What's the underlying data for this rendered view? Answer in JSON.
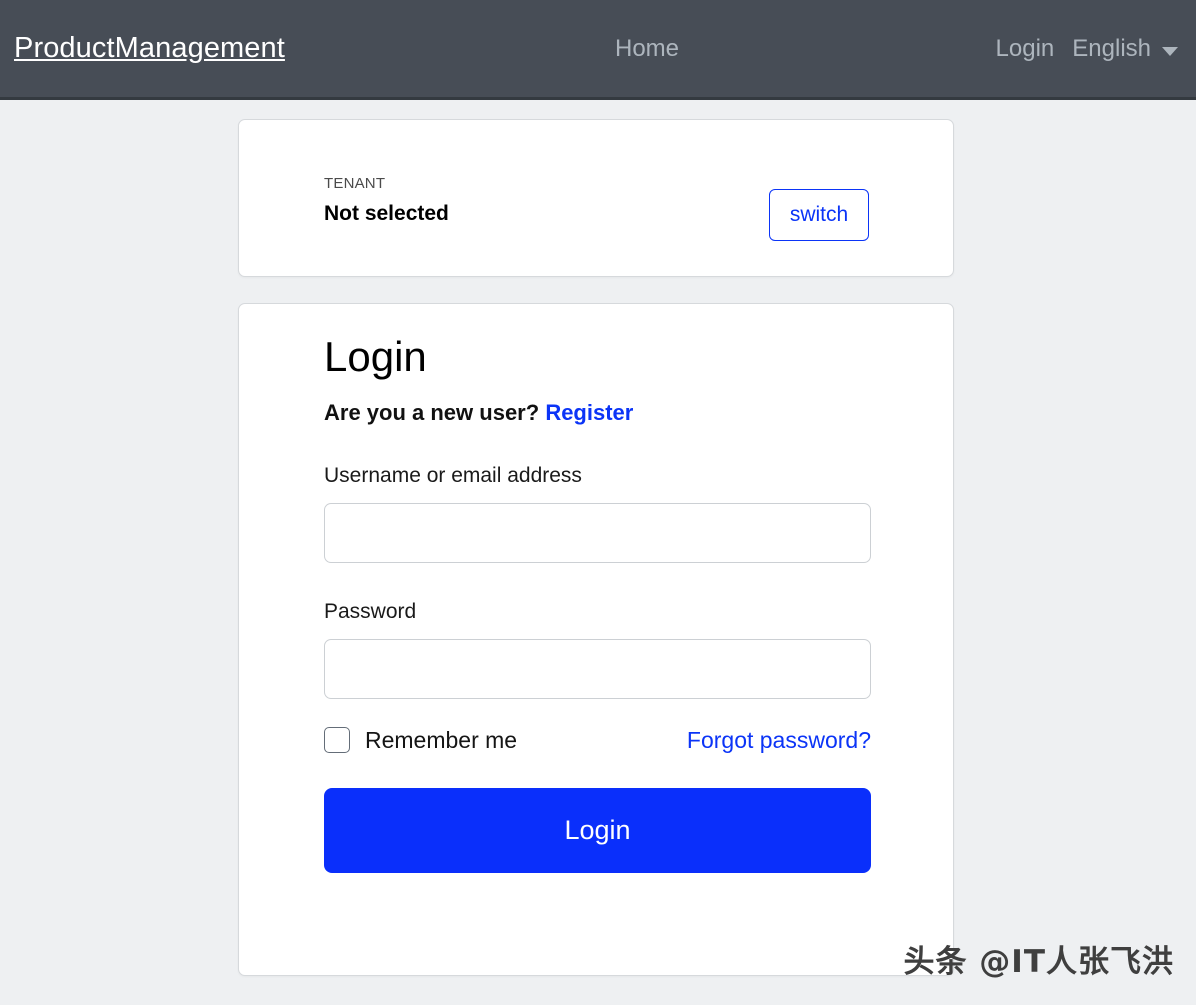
{
  "navbar": {
    "brand": "ProductManagement",
    "center_links": [
      {
        "label": "Home",
        "name": "nav-link-home"
      }
    ],
    "right_links": [
      {
        "label": "Login",
        "name": "nav-link-login"
      }
    ],
    "language": {
      "label": "English",
      "caret_icon": "chevron-down-icon"
    }
  },
  "tenant_card": {
    "label": "TENANT",
    "value": "Not selected",
    "switch_button": "switch"
  },
  "login_card": {
    "title": "Login",
    "new_user_text": "Are you a new user?",
    "register_link": "Register",
    "username": {
      "label": "Username or email address",
      "value": "",
      "placeholder": ""
    },
    "password": {
      "label": "Password",
      "value": "",
      "placeholder": ""
    },
    "remember_me": {
      "label": "Remember me",
      "checked": false
    },
    "forgot_link": "Forgot password?",
    "submit_button": "Login"
  },
  "watermark": {
    "text": "头条 @IT人张飞洪"
  },
  "colors": {
    "navbar_bg": "#474d56",
    "navbar_border": "#343a40",
    "page_bg": "#eef0f2",
    "card_bg": "#ffffff",
    "card_border": "#d6d9dc",
    "accent_blue": "#0a2ffb",
    "link_blue": "#0b34f7",
    "nav_link": "#adb5bd",
    "input_border": "#ccd0d4"
  }
}
